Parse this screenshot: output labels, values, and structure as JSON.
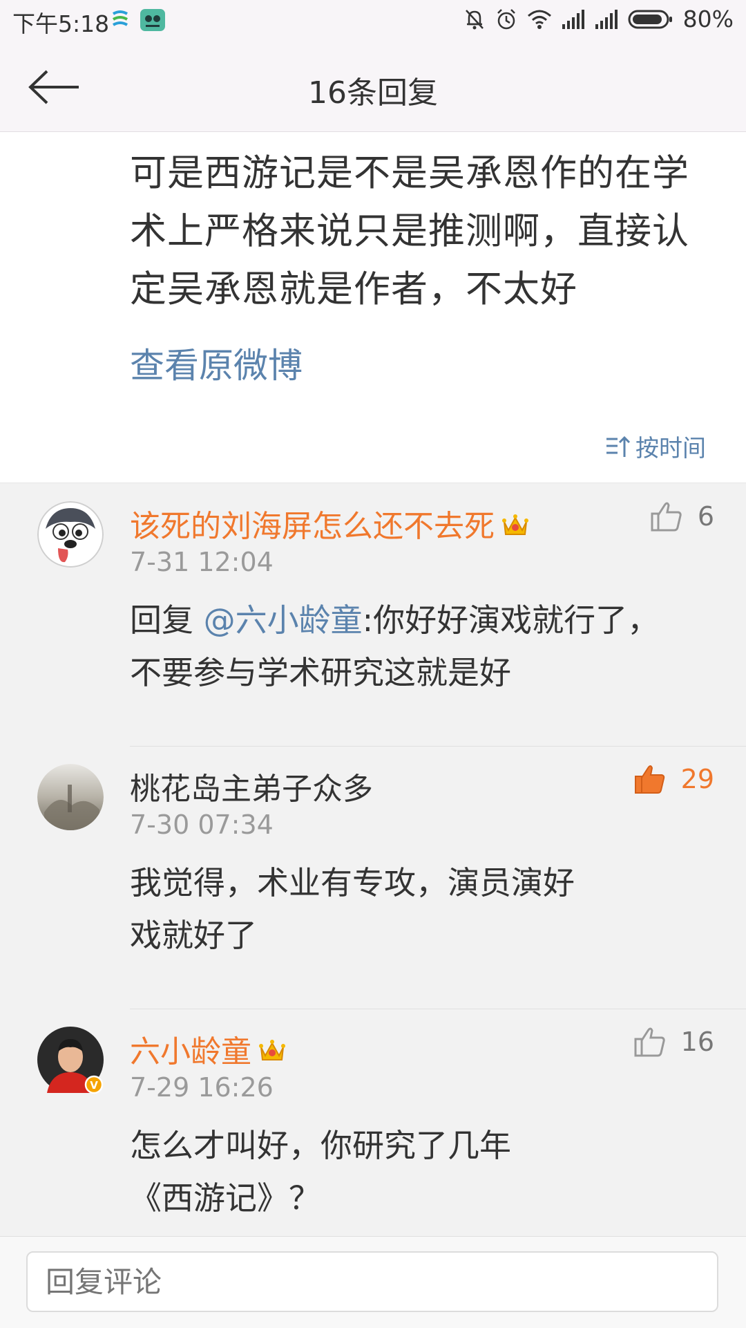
{
  "status_bar": {
    "time": "下午5:18",
    "battery": "80%"
  },
  "header": {
    "title": "16条回复"
  },
  "post": {
    "text": "可是西游记是不是吴承恩作的在学术上严格来说只是推测啊，直接认定吴承恩就是作者，不太好",
    "view_original": "查看原微博",
    "sort_label": "按时间"
  },
  "comments": [
    {
      "username": "该死的刘海屏怎么还不去死",
      "vip": true,
      "time": "7-31 12:04",
      "reply_prefix": "回复 ",
      "mention": "@六小龄童",
      "text": ":你好好演戏就行了，不要参与学术研究这就是好",
      "likes": "6",
      "liked": false
    },
    {
      "username": "桃花岛主弟子众多",
      "vip": false,
      "time": "7-30 07:34",
      "text": "我觉得，术业有专攻，演员演好戏就好了",
      "likes": "29",
      "liked": true
    },
    {
      "username": "六小龄童",
      "vip": true,
      "verified": true,
      "time": "7-29 16:26",
      "text": "怎么才叫好，你研究了几年《西游记》？",
      "likes": "16",
      "liked": false
    }
  ],
  "reply_bar": {
    "placeholder": "回复评论"
  },
  "colors": {
    "accent_orange": "#f0782d",
    "link_blue": "#5b83ad"
  }
}
